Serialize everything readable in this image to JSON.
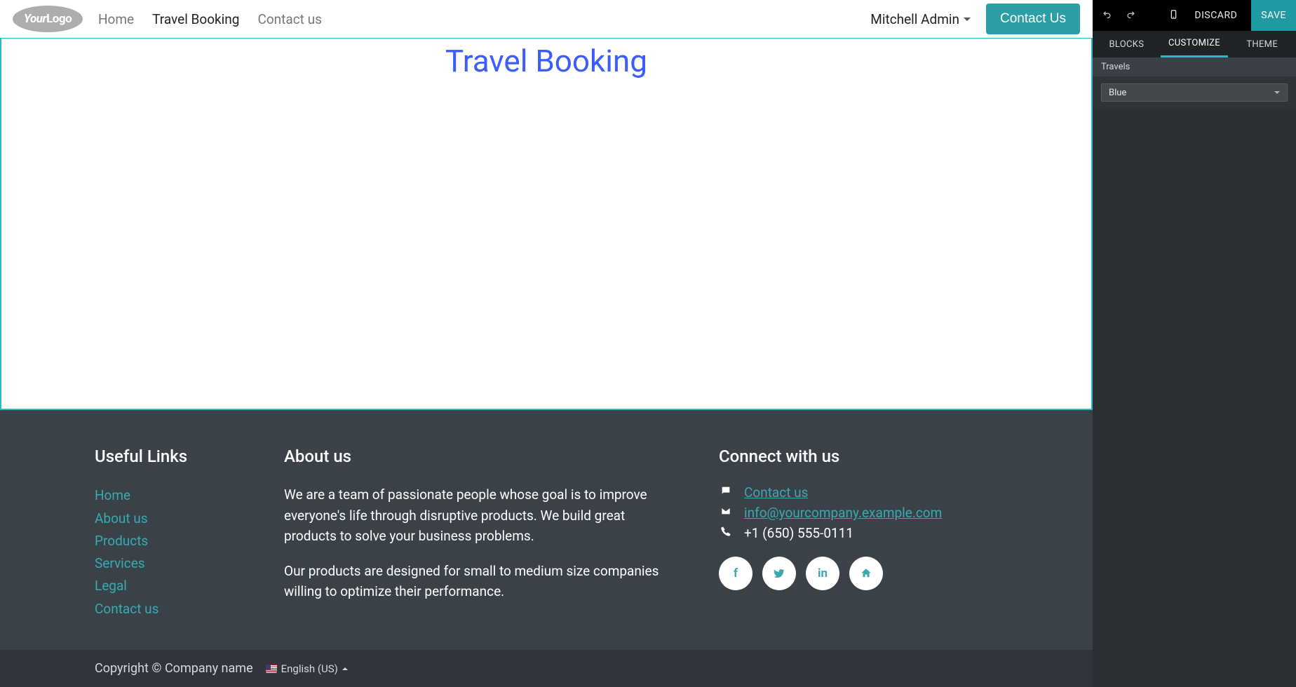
{
  "navbar": {
    "logo_your": "Your",
    "logo_logo": "Logo",
    "links": [
      {
        "label": "Home",
        "active": false
      },
      {
        "label": "Travel Booking",
        "active": true
      },
      {
        "label": "Contact us",
        "active": false
      }
    ],
    "user": "Mitchell Admin",
    "contact_btn": "Contact Us"
  },
  "page": {
    "title": "Travel Booking"
  },
  "footer": {
    "useful_links_heading": "Useful Links",
    "links": [
      "Home",
      "About us",
      "Products",
      "Services",
      "Legal",
      "Contact us"
    ],
    "about_heading": "About us",
    "about_p1": "We are a team of passionate people whose goal is to improve everyone's life through disruptive products. We build great products to solve your business problems.",
    "about_p2": "Our products are designed for small to medium size companies willing to optimize their performance.",
    "connect_heading": "Connect with us",
    "contact_label": "Contact us",
    "email": "info@yourcompany.example.com",
    "phone": "+1 (650) 555-0111",
    "social": {
      "facebook": "f",
      "twitter": "t",
      "linkedin": "in",
      "home": "⌂"
    }
  },
  "subfooter": {
    "copyright": "Copyright © Company name",
    "language": "English (US)"
  },
  "editor": {
    "discard": "DISCARD",
    "save": "SAVE",
    "tabs": {
      "blocks": "BLOCKS",
      "customize": "CUSTOMIZE",
      "theme": "THEME"
    },
    "section": "Travels",
    "color_value": "Blue"
  }
}
